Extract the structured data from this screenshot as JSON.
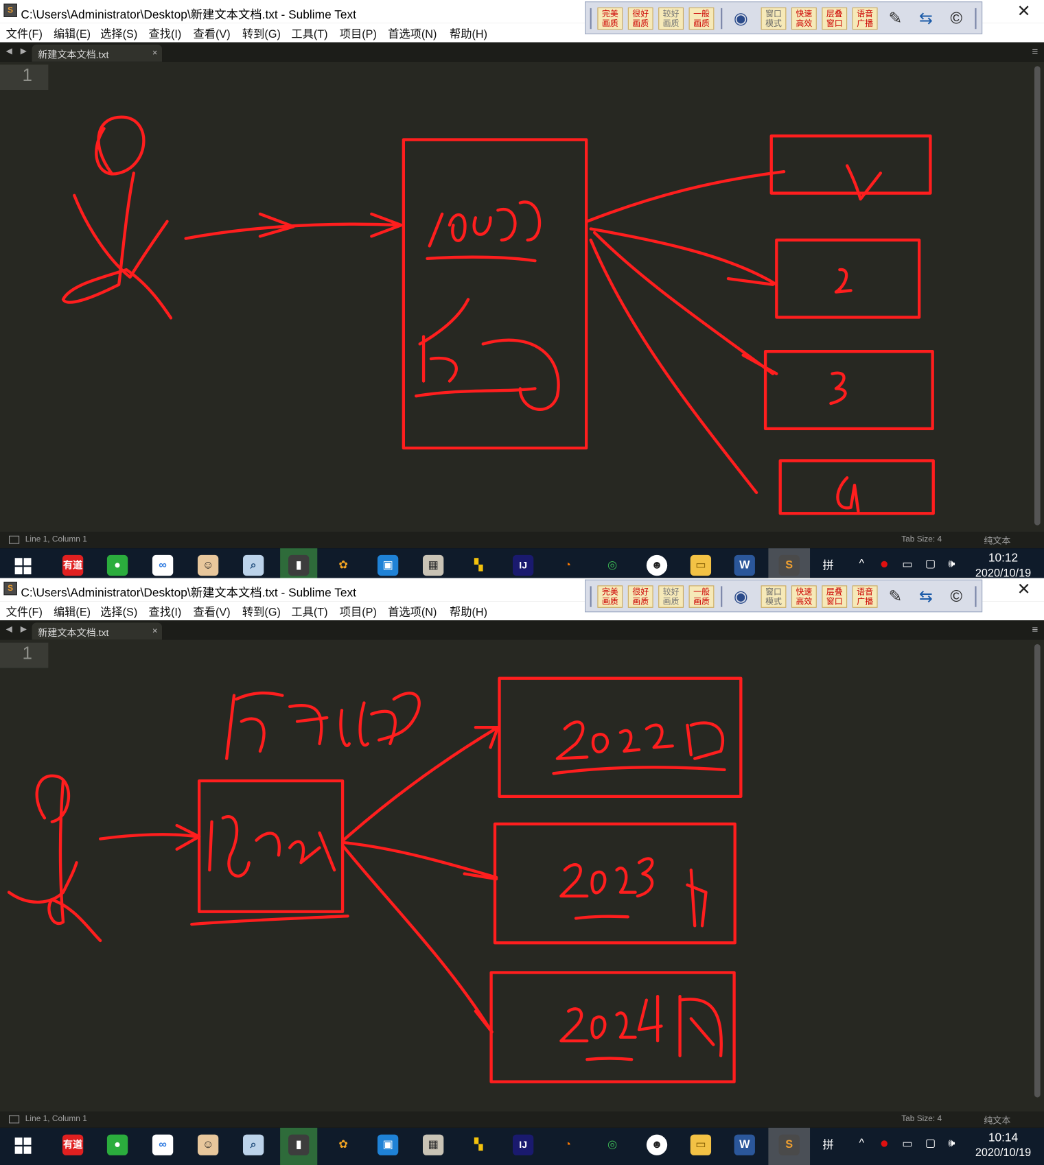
{
  "window": {
    "title": "C:\\Users\\Administrator\\Desktop\\新建文本文档.txt - Sublime Text",
    "app_icon": "sublime-text-icon",
    "close_glyph": "✕"
  },
  "menu": [
    "文件(F)",
    "编辑(E)",
    "选择(S)",
    "查找(I)",
    "查看(V)",
    "转到(G)",
    "工具(T)",
    "项目(P)",
    "首选项(N)",
    "帮助(H)"
  ],
  "toolbar": {
    "quality_buttons": [
      "完美画质",
      "很好画质",
      "较好画质",
      "一般画质"
    ],
    "mode_buttons": [
      "窗口模式",
      "快速高效",
      "层叠窗口",
      "语音广播"
    ],
    "icons": [
      "remote-view-icon",
      "pen-icon",
      "monitor-transfer-icon",
      "screen-c-icon"
    ]
  },
  "tab": {
    "filename": "新建文本文档.txt",
    "close_glyph": "×",
    "nav_arrows": "◀ ▶",
    "menu_glyph": "≡"
  },
  "editor": {
    "line_number": "1",
    "theme": "Monokai",
    "background": "#272822",
    "ink_color": "#ff1e1e"
  },
  "status": {
    "position": "Line 1, Column 1",
    "tab_size": "Tab Size: 4",
    "syntax": "纯文本"
  },
  "taskbar": {
    "apps": [
      {
        "name": "youdao-dict-icon",
        "label": "有道"
      },
      {
        "name": "wechat-icon",
        "label": ""
      },
      {
        "name": "baidu-netdisk-icon",
        "label": ""
      },
      {
        "name": "avatar-app-icon",
        "label": ""
      },
      {
        "name": "magnifier-app-icon",
        "label": ""
      },
      {
        "name": "camera-app-icon",
        "label": ""
      },
      {
        "name": "360-icon",
        "label": ""
      },
      {
        "name": "remote-desktop-icon",
        "label": ""
      },
      {
        "name": "photo-app-icon",
        "label": ""
      },
      {
        "name": "tiles-app-icon",
        "label": ""
      },
      {
        "name": "intellij-icon",
        "label": "IJ"
      },
      {
        "name": "firefox-icon",
        "label": ""
      },
      {
        "name": "chrome-icon",
        "label": ""
      },
      {
        "name": "smiley-app-icon",
        "label": ""
      },
      {
        "name": "file-explorer-icon",
        "label": ""
      },
      {
        "name": "word-icon",
        "label": "W"
      },
      {
        "name": "sublime-taskbar-icon",
        "label": "S"
      }
    ],
    "ime": "拼",
    "tray": {
      "chevron": "^",
      "volume_glyph": "🕪"
    },
    "screens": [
      {
        "time": "10:12",
        "date": "2020/10/19"
      },
      {
        "time": "10:14",
        "date": "2020/10/19"
      }
    ]
  },
  "drawings": {
    "top_labels": [
      "10086",
      "反向",
      "1",
      "2",
      "3",
      "4"
    ],
    "bottom_labels": [
      "反向代理",
      "nginx",
      "2022",
      "2023",
      "2024"
    ]
  }
}
